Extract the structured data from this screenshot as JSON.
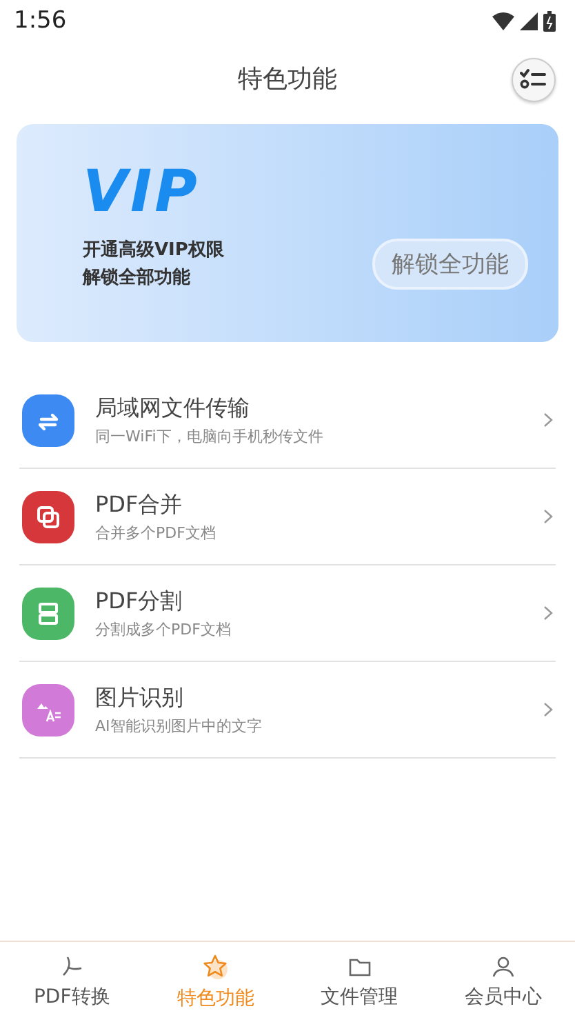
{
  "status_bar": {
    "time": "1:56"
  },
  "header": {
    "title": "特色功能"
  },
  "vip_banner": {
    "logo": "VIP",
    "lines": [
      "开通高级VIP权限",
      "解锁全部功能"
    ],
    "button": "解锁全功能"
  },
  "features": [
    {
      "kind": "transfer",
      "color": "#3d8bf2",
      "title": "局域网文件传输",
      "subtitle": "同一WiFi下，电脑向手机秒传文件"
    },
    {
      "kind": "merge",
      "color": "#d6373a",
      "title": "PDF合并",
      "subtitle": "合并多个PDF文档"
    },
    {
      "kind": "split",
      "color": "#4cb867",
      "title": "PDF分割",
      "subtitle": "分割成多个PDF文档"
    },
    {
      "kind": "ocr",
      "color": "#d27ad8",
      "title": "图片识别",
      "subtitle": "AI智能识别图片中的文字"
    }
  ],
  "tabs": [
    {
      "kind": "pdf",
      "label": "PDF转换",
      "selected": false
    },
    {
      "kind": "star",
      "label": "特色功能",
      "selected": true
    },
    {
      "kind": "folder",
      "label": "文件管理",
      "selected": false
    },
    {
      "kind": "member",
      "label": "会员中心",
      "selected": false
    }
  ]
}
